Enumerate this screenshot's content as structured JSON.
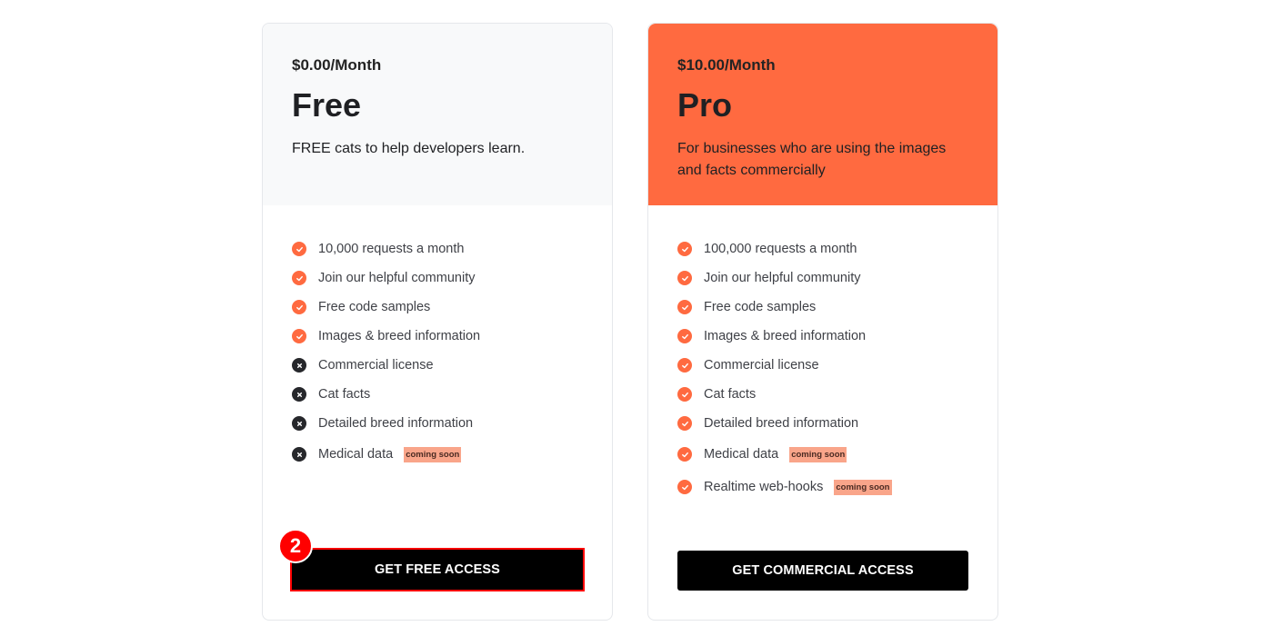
{
  "plans": {
    "free": {
      "price": "$0.00/Month",
      "name": "Free",
      "description": "FREE cats to help developers learn.",
      "features": [
        {
          "label": "10,000 requests a month",
          "included": true
        },
        {
          "label": "Join our helpful community",
          "included": true
        },
        {
          "label": "Free code samples",
          "included": true
        },
        {
          "label": "Images & breed information",
          "included": true
        },
        {
          "label": "Commercial license",
          "included": false
        },
        {
          "label": "Cat facts",
          "included": false
        },
        {
          "label": "Detailed breed information",
          "included": false
        },
        {
          "label": "Medical data",
          "included": false,
          "badge": "coming soon"
        }
      ],
      "cta_label": "GET FREE ACCESS"
    },
    "pro": {
      "price": "$10.00/Month",
      "name": "Pro",
      "description": "For businesses who are using the images and facts commercially",
      "features": [
        {
          "label": "100,000 requests a month",
          "included": true
        },
        {
          "label": "Join our helpful community",
          "included": true
        },
        {
          "label": "Free code samples",
          "included": true
        },
        {
          "label": "Images & breed information",
          "included": true
        },
        {
          "label": "Commercial license",
          "included": true
        },
        {
          "label": "Cat facts",
          "included": true
        },
        {
          "label": "Detailed breed information",
          "included": true
        },
        {
          "label": "Medical data",
          "included": true,
          "badge": "coming soon"
        },
        {
          "label": "Realtime web-hooks",
          "included": true,
          "badge": "coming soon"
        }
      ],
      "cta_label": "GET COMMERCIAL ACCESS"
    }
  },
  "step_marker": "2",
  "colors": {
    "accent": "#ff6a40",
    "free_header_bg": "#f8f9fa",
    "button_bg": "#000000",
    "badge_bg": "#f9a58a",
    "marker": "#ff0000"
  },
  "icons": {
    "included": "check-circle-icon",
    "excluded": "x-circle-icon"
  }
}
